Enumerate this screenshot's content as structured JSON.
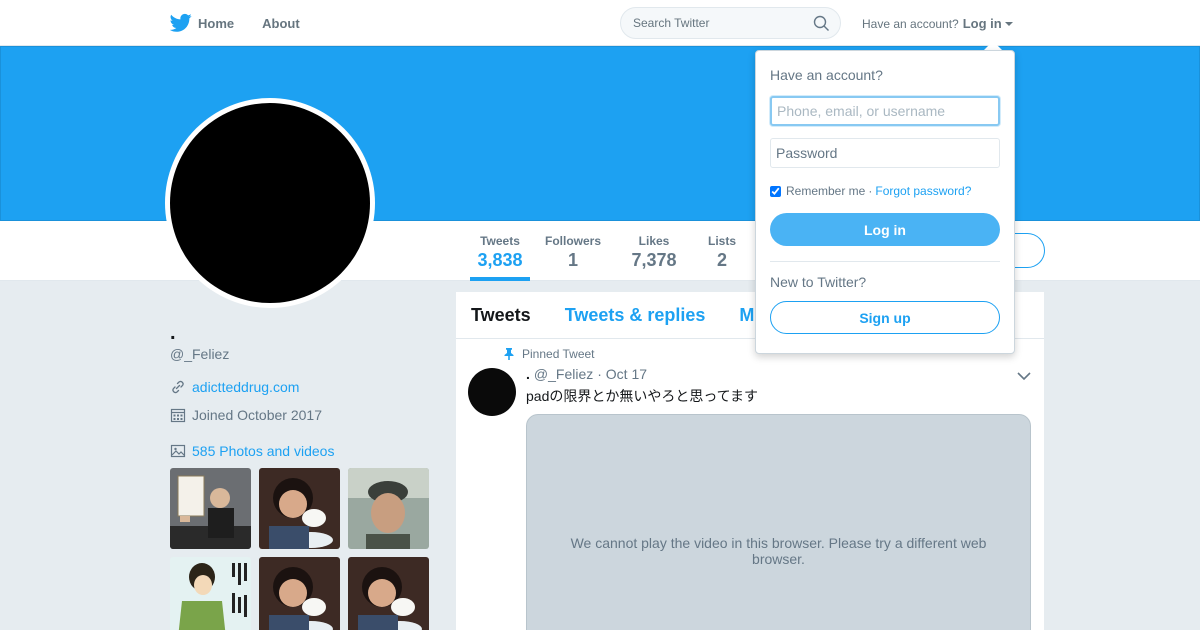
{
  "nav": {
    "home_label": "Home",
    "about_label": "About",
    "search_placeholder": "Search Twitter",
    "have_account": "Have an account?",
    "login_label": "Log in"
  },
  "colors": {
    "brand": "#1da1f2",
    "banner": "#1da1f2",
    "background": "#e6ecf0"
  },
  "profile": {
    "name": ".",
    "handle": "@_Feliez",
    "website": "adictteddrug.com",
    "joined": "Joined October 2017",
    "photos_label": "585 Photos and videos"
  },
  "stats": [
    {
      "label": "Tweets",
      "value": "3,838",
      "active": true
    },
    {
      "label": "Followers",
      "value": "1"
    },
    {
      "label": "Likes",
      "value": "7,378"
    },
    {
      "label": "Lists",
      "value": "2"
    }
  ],
  "timeline": {
    "tabs": [
      "Tweets",
      "Tweets & replies",
      "M"
    ],
    "pinned_label": "Pinned Tweet",
    "tweet": {
      "name": ".",
      "handle": "@_Feliez",
      "date": "· Oct 17",
      "text": "padの限界とか無いやろと思ってます",
      "video_message": "We cannot play the video in this browser. Please try a different web browser."
    }
  },
  "login_dropdown": {
    "title": "Have an account?",
    "username_placeholder": "Phone, email, or username",
    "password_placeholder": "Password",
    "remember_label": "Remember me",
    "separator": "·",
    "forgot_label": "Forgot password?",
    "login_button": "Log in",
    "new_label": "New to Twitter?",
    "signup_button": "Sign up"
  },
  "media_thumbnails": [
    "photo-sign",
    "photo-girl-rice",
    "photo-man-cap",
    "photo-manga",
    "photo-girl-rice",
    "photo-girl-rice"
  ]
}
